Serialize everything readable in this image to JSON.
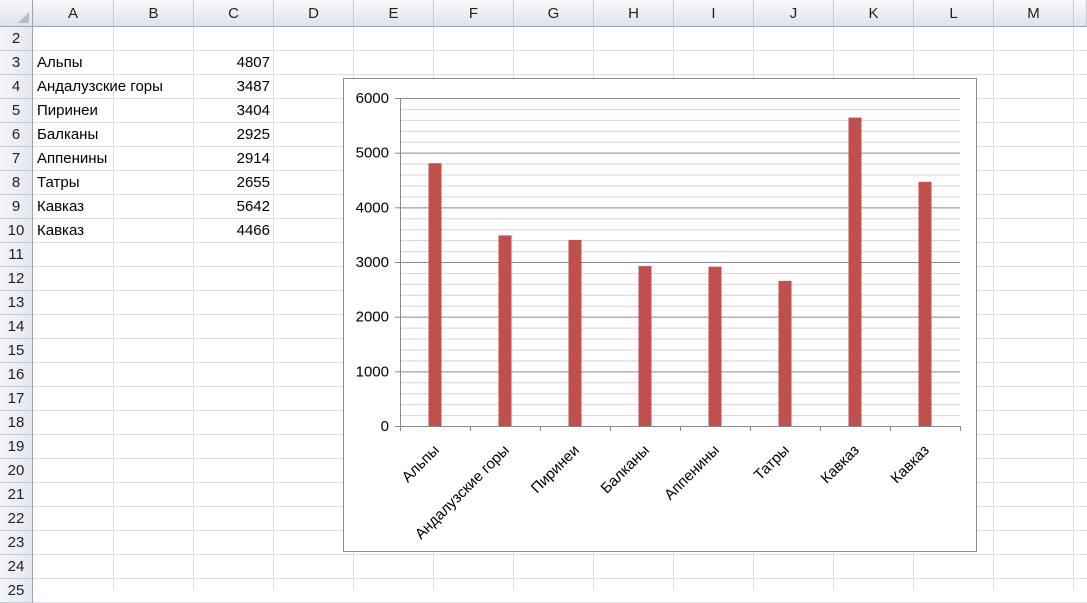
{
  "columns": [
    "A",
    "B",
    "C",
    "D",
    "E",
    "F",
    "G",
    "H",
    "I",
    "J",
    "K",
    "L",
    "M"
  ],
  "rows": [
    "2",
    "3",
    "4",
    "5",
    "6",
    "7",
    "8",
    "9",
    "10",
    "11",
    "12",
    "13",
    "14",
    "15",
    "16",
    "17",
    "18",
    "19",
    "20",
    "21",
    "22",
    "23",
    "24",
    "25"
  ],
  "cells": [
    {
      "row": "3",
      "a": "Альпы",
      "c": "4807"
    },
    {
      "row": "4",
      "a": "Андалузские горы",
      "c": "3487"
    },
    {
      "row": "5",
      "a": "Пиринеи",
      "c": "3404"
    },
    {
      "row": "6",
      "a": "Балканы",
      "c": "2925"
    },
    {
      "row": "7",
      "a": "Аппенины",
      "c": "2914"
    },
    {
      "row": "8",
      "a": "Татры",
      "c": "2655"
    },
    {
      "row": "9",
      "a": "Кавказ",
      "c": "5642"
    },
    {
      "row": "10",
      "a": "Кавказ",
      "c": "4466"
    }
  ],
  "chart_data": {
    "type": "bar",
    "categories": [
      "Альпы",
      "Андалузские горы",
      "Пиринеи",
      "Балканы",
      "Аппенины",
      "Татры",
      "Кавказ",
      "Кавказ"
    ],
    "values": [
      4807,
      3487,
      3404,
      2925,
      2914,
      2655,
      5642,
      4466
    ],
    "ylim": [
      0,
      6000
    ],
    "yticks": [
      0,
      1000,
      2000,
      3000,
      4000,
      5000,
      6000
    ],
    "yticks_labels": [
      "0",
      "1000",
      "2000",
      "3000",
      "4000",
      "5000",
      "6000"
    ],
    "minor_step": 200,
    "bar_color": "#c0504d",
    "grid": true,
    "legend": "none"
  }
}
